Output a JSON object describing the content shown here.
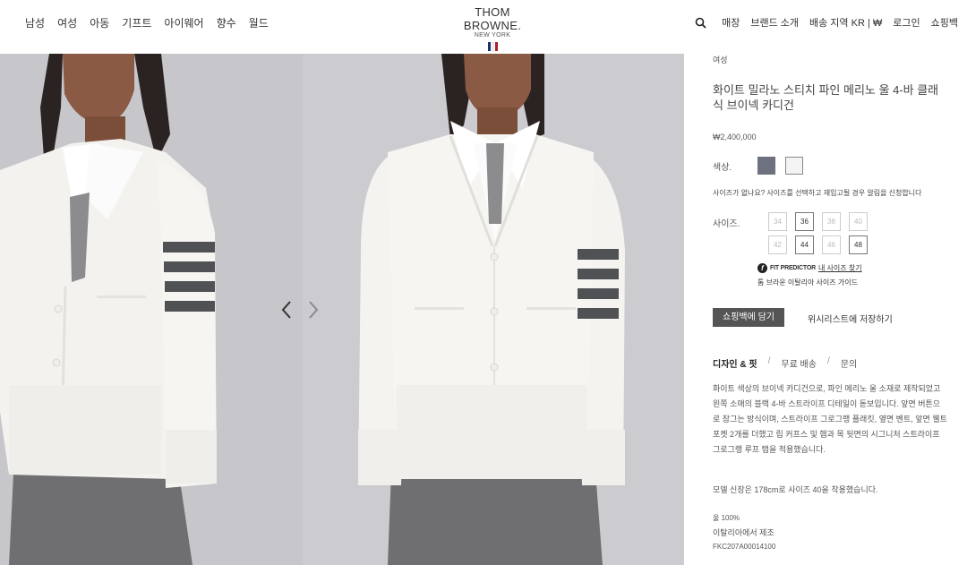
{
  "header": {
    "nav_left": [
      "남성",
      "여성",
      "아동",
      "기프트",
      "아이웨어",
      "향수",
      "월드"
    ],
    "logo_main": "THOM BROWNE.",
    "logo_sub": "NEW YORK",
    "nav_right": [
      "매장",
      "브랜드 소개",
      "배송 지역 KR | ₩",
      "로그인",
      "쇼핑백"
    ]
  },
  "product": {
    "category": "여성",
    "title": "화이트 밀라노 스티치 파인 메리노 울 4-바 클래식 브이넥 카디건",
    "price": "₩2,400,000",
    "color_label": "색상.",
    "size_note": "사이즈가 없나요? 사이즈를 선택하고 재입고될 경우 알림을 신청합니다",
    "size_label": "사이즈.",
    "sizes_row1": [
      "34",
      "36",
      "38",
      "40"
    ],
    "sizes_row2": [
      "42",
      "44",
      "46",
      "48"
    ],
    "fit_predictor": "FIT PREDICTOR",
    "fit_link": "내 사이즈 찾기",
    "size_guide": "톰 브라운 이탈리아 사이즈 가이드",
    "add_to_bag": "쇼핑백에 담기",
    "wishlist": "위시리스트에 저장하기",
    "tabs": [
      "디자인 & 핏",
      "무료 배송",
      "문의"
    ],
    "description": "화이트 색상의 브이넥 카디건으로, 파인 메리노 울 소재로 제작되었고 왼쪽 소매의 블랙 4-바 스트라이프 디테일이 돋보입니다. 앞면 버튼으로 잠그는 방식이며, 스트라이프 그로그랭 플래킷, 옆면 벤트, 앞면 웰트 포켓 2개를 더했고 립 커프스 및 헴과 목 뒷면의 시그니처 스트라이프 그로그랭 루프 탭을 적용했습니다.",
    "model_info": "모델 신장은 178cm로 사이즈 40을 착용했습니다.",
    "material": "울 100%",
    "made_in": "이탈리아에서 제조",
    "sku": "FKC207A00014100"
  },
  "colors": {
    "swatch_grey": "#6e7180",
    "swatch_white": "#f4f4f4",
    "flag_blue": "#1d2f6f",
    "flag_red": "#b01c2e"
  }
}
